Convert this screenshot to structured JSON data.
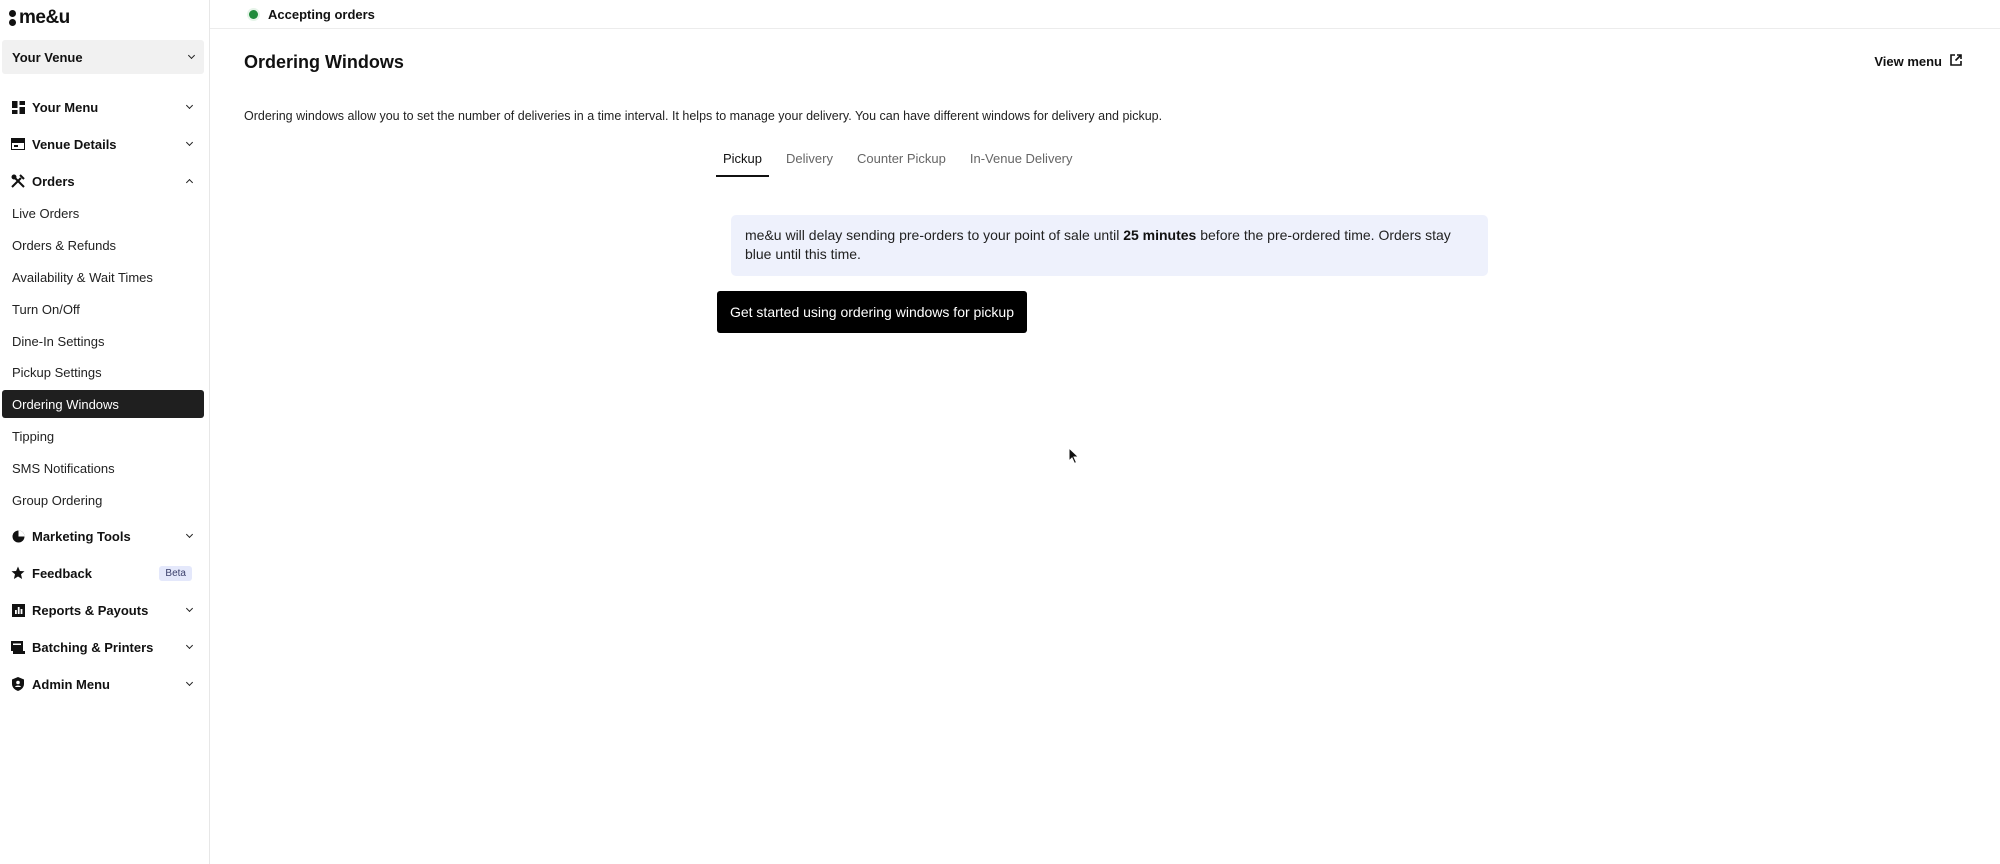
{
  "app": {
    "logo_text": "me&u"
  },
  "sidebar": {
    "venue_label": "Your Venue",
    "sections": [
      {
        "label": "Your Menu",
        "icon": "grid-icon"
      },
      {
        "label": "Venue Details",
        "icon": "storefront-icon"
      },
      {
        "label": "Orders",
        "icon": "utensils-icon"
      },
      {
        "label": "Marketing Tools",
        "icon": "pie-chart-icon"
      },
      {
        "label": "Feedback",
        "icon": "star-icon",
        "badge": "Beta"
      },
      {
        "label": "Reports & Payouts",
        "icon": "bar-chart-icon"
      },
      {
        "label": "Batching & Printers",
        "icon": "printer-icon"
      },
      {
        "label": "Admin Menu",
        "icon": "shield-icon"
      }
    ],
    "orders_items": [
      "Live Orders",
      "Orders & Refunds",
      "Availability & Wait Times",
      "Turn On/Off",
      "Dine-In Settings",
      "Pickup Settings",
      "Ordering Windows",
      "Tipping",
      "SMS Notifications",
      "Group Ordering"
    ],
    "active_item": "Ordering Windows"
  },
  "topbar": {
    "status_text": "Accepting orders",
    "status_color": "#1f8a3b"
  },
  "main": {
    "title": "Ordering Windows",
    "view_menu_label": "View menu",
    "description": "Ordering windows allow you to set the number of deliveries in a time interval. It helps to manage your delivery. You can have different windows for delivery and pickup.",
    "tabs": [
      "Pickup",
      "Delivery",
      "Counter Pickup",
      "In-Venue Delivery"
    ],
    "active_tab": "Pickup",
    "info": {
      "before": "me&u will delay sending pre-orders to your point of sale until ",
      "bold": "25 minutes",
      "after": " before the pre-ordered time. Orders stay blue until this time."
    },
    "cta_label": "Get started using ordering windows for pickup"
  },
  "colors": {
    "accent": "#000000",
    "info_bg": "#eef1fc",
    "active_nav_bg": "#1f1f1f"
  }
}
